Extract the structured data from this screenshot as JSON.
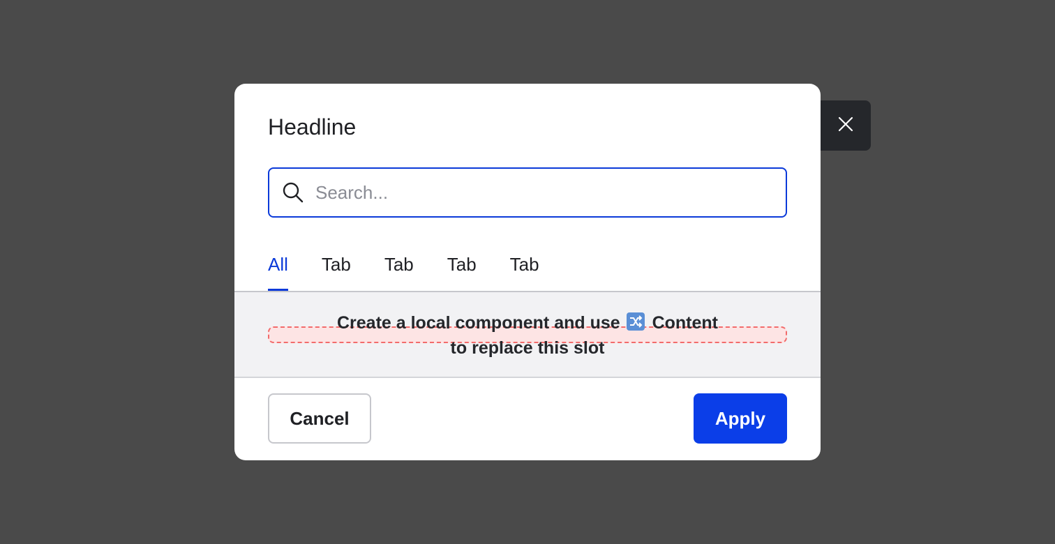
{
  "dialog": {
    "headline": "Headline",
    "close_icon": "close-icon"
  },
  "search": {
    "placeholder": "Search...",
    "value": "",
    "icon": "search-icon"
  },
  "tabs": [
    {
      "label": "All",
      "active": true
    },
    {
      "label": "Tab",
      "active": false
    },
    {
      "label": "Tab",
      "active": false
    },
    {
      "label": "Tab",
      "active": false
    },
    {
      "label": "Tab",
      "active": false
    }
  ],
  "slot": {
    "line1_before": "Create a local component and use",
    "icon": "shuffle-icon",
    "line1_after": "Content",
    "line2": "to replace this slot"
  },
  "footer": {
    "cancel_label": "Cancel",
    "apply_label": "Apply"
  },
  "colors": {
    "accent": "#0b3ad9",
    "apply_bg": "#0b3ee8",
    "overlay": "#4a4a4a",
    "close_bg": "#25272b",
    "slot_bg": "#f2f2f4",
    "slot_dashed": "#f26b6b"
  }
}
